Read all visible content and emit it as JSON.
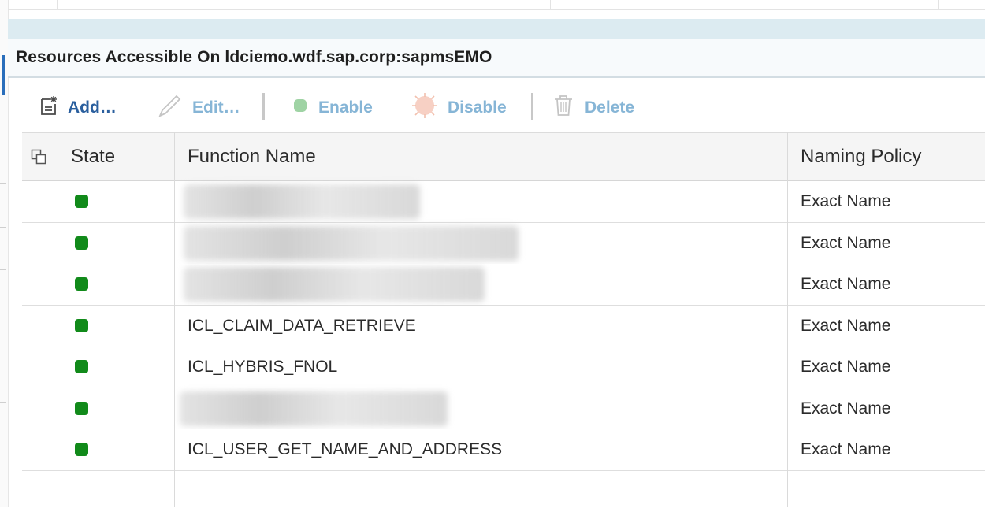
{
  "panel": {
    "title": "Resources Accessible On ldciemo.wdf.sap.corp:sapmsEMO"
  },
  "toolbar": {
    "add_label": "Add…",
    "edit_label": "Edit…",
    "enable_label": "Enable",
    "disable_label": "Disable",
    "delete_label": "Delete"
  },
  "table": {
    "columns": {
      "state": "State",
      "function_name": "Function Name",
      "naming_policy": "Naming Policy"
    },
    "rows": [
      {
        "state": "enabled",
        "function_name": "",
        "redacted": true,
        "naming_policy": "Exact Name"
      },
      {
        "state": "enabled",
        "function_name": "",
        "redacted": true,
        "naming_policy": "Exact Name"
      },
      {
        "state": "enabled",
        "function_name": "",
        "redacted": true,
        "naming_policy": "Exact Name"
      },
      {
        "state": "enabled",
        "function_name": "ICL_CLAIM_DATA_RETRIEVE",
        "redacted": false,
        "naming_policy": "Exact Name"
      },
      {
        "state": "enabled",
        "function_name": "ICL_HYBRIS_FNOL",
        "redacted": false,
        "naming_policy": "Exact Name"
      },
      {
        "state": "enabled",
        "function_name": "",
        "redacted": true,
        "naming_policy": "Exact Name"
      },
      {
        "state": "enabled",
        "function_name": "ICL_USER_GET_NAME_AND_ADDRESS",
        "redacted": false,
        "naming_policy": "Exact Name"
      }
    ]
  },
  "colors": {
    "state_enabled": "#118a1a",
    "toolbar_enabled": "#2a5f9e",
    "toolbar_disabled": "#86b5d6",
    "band": "#dcebf1"
  }
}
